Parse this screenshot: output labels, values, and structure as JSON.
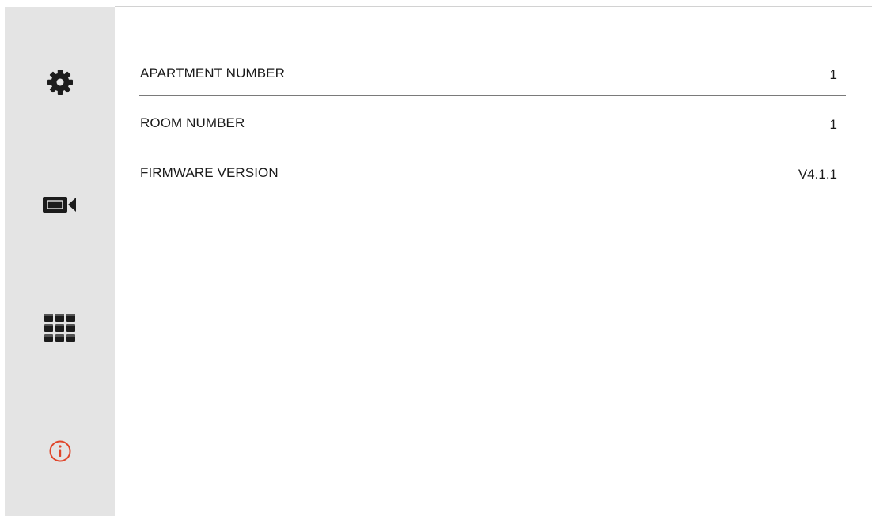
{
  "sidebar": {
    "items": [
      {
        "icon": "gear-icon",
        "active": false
      },
      {
        "icon": "camera-icon",
        "active": false
      },
      {
        "icon": "keypad-grid-icon",
        "active": false
      },
      {
        "icon": "info-icon",
        "active": true
      }
    ],
    "icon_color": "#1c1c1c",
    "active_color": "#e0452a",
    "background": "#e4e4e4"
  },
  "info": {
    "rows": [
      {
        "label": "APARTMENT NUMBER",
        "value": "1"
      },
      {
        "label": "ROOM NUMBER",
        "value": "1"
      },
      {
        "label": "FIRMWARE VERSION",
        "value": "V4.1.1"
      }
    ]
  }
}
